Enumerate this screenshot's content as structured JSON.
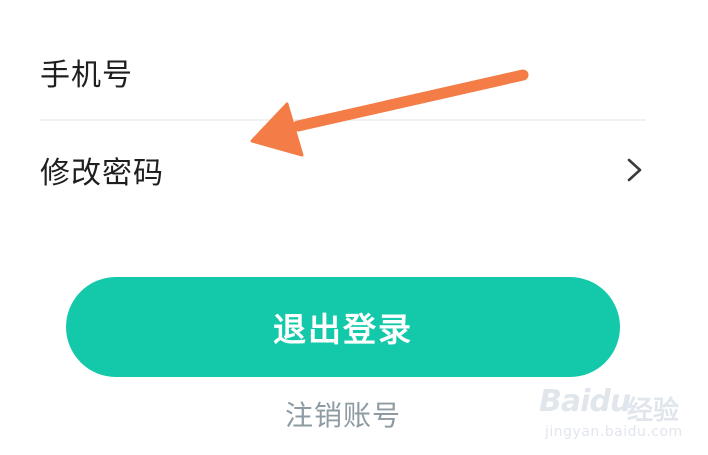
{
  "settings": {
    "phone_label": "手机号",
    "password_label": "修改密码"
  },
  "actions": {
    "logout_label": "退出登录",
    "cancel_account_label": "注销账号"
  },
  "watermark": {
    "brand": "Baidu",
    "suffix": "经验",
    "url": "jingyan.baidu.com"
  },
  "icons": {
    "chevron": "chevron-right-icon",
    "annotation": "arrow-annotation-icon"
  },
  "colors": {
    "accent": "#14c8aa",
    "arrow": "#f47c46",
    "text": "#1f1f1f",
    "muted": "#8e9ba3",
    "divider": "#eef2f1"
  }
}
